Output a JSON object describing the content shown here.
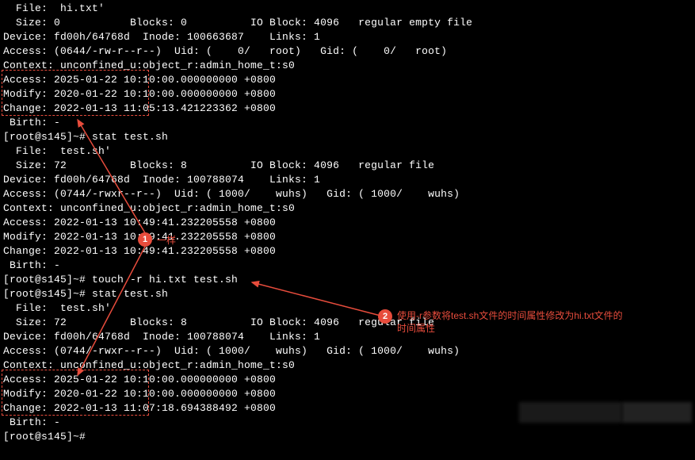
{
  "terminal": {
    "lines": [
      "  File:  hi.txt'",
      "  Size: 0           Blocks: 0          IO Block: 4096   regular empty file",
      "Device: fd00h/64768d  Inode: 100663687    Links: 1",
      "Access: (0644/-rw-r--r--)  Uid: (    0/   root)   Gid: (    0/   root)",
      "Context: unconfined_u:object_r:admin_home_t:s0",
      "Access: 2025-01-22 10:10:00.000000000 +0800",
      "Modify: 2020-01-22 10:10:00.000000000 +0800",
      "Change: 2022-01-13 11:05:13.421223362 +0800",
      " Birth: -",
      "[root@s145]~# stat test.sh",
      "  File:  test.sh'",
      "  Size: 72          Blocks: 8          IO Block: 4096   regular file",
      "Device: fd00h/64768d  Inode: 100788074    Links: 1",
      "Access: (0744/-rwxr--r--)  Uid: ( 1000/    wuhs)   Gid: ( 1000/    wuhs)",
      "Context: unconfined_u:object_r:admin_home_t:s0",
      "Access: 2022-01-13 10:49:41.232205558 +0800",
      "Modify: 2022-01-13 10:49:41.232205558 +0800",
      "Change: 2022-01-13 10:49:41.232205558 +0800",
      " Birth: -",
      "[root@s145]~# touch -r hi.txt test.sh",
      "[root@s145]~# stat test.sh",
      "  File:  test.sh'",
      "  Size: 72          Blocks: 8          IO Block: 4096   regular file",
      "Device: fd00h/64768d  Inode: 100788074    Links: 1",
      "Access: (0744/-rwxr--r--)  Uid: ( 1000/    wuhs)   Gid: ( 1000/    wuhs)",
      "Context: unconfined_u:object_r:admin_home_t:s0",
      "Access: 2025-01-22 10:10:00.000000000 +0800",
      "Modify: 2020-01-22 10:10:00.000000000 +0800",
      "Change: 2022-01-13 11:07:18.694388492 +0800",
      " Birth: -",
      "[root@s145]~#"
    ]
  },
  "annotations": {
    "label1_num": "1",
    "label1_text": "一样",
    "label2_num": "2",
    "label2_text_line1": "使用-r参数将test.sh文件的时间属性修改为hi.txt文件的",
    "label2_text_line2": "时间属性"
  }
}
